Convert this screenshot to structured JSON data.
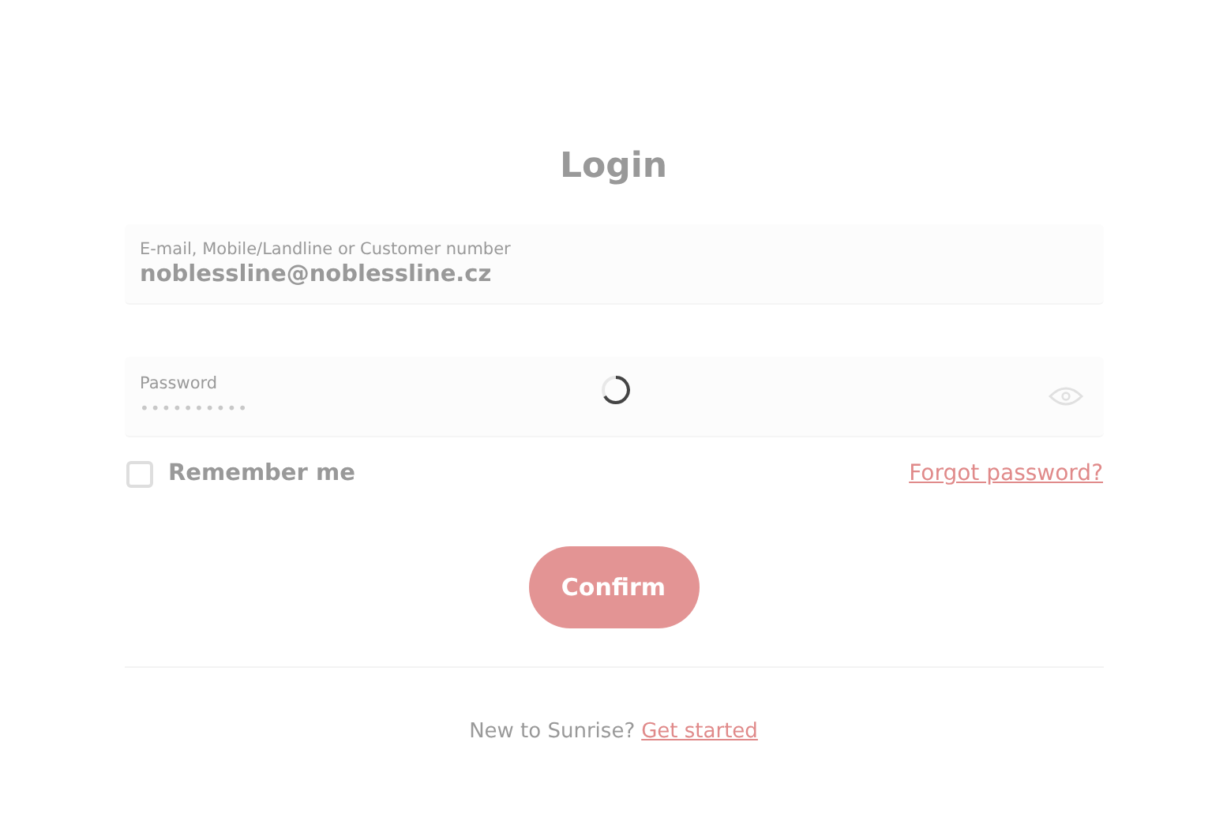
{
  "loading": true,
  "title": "Login",
  "fields": [
    {
      "kind": "text",
      "label": "E-mail, Mobile/Landline or Customer number",
      "value": "noblessline@noblessline.cz"
    },
    {
      "kind": "password",
      "label": "Password",
      "value": "••••••••••"
    }
  ],
  "remember": {
    "label": "Remember me",
    "checked": false
  },
  "forgot_link": "Forgot password?",
  "confirm_button": "Confirm",
  "footer": {
    "text": "New to Sunrise?",
    "link": "Get started"
  }
}
